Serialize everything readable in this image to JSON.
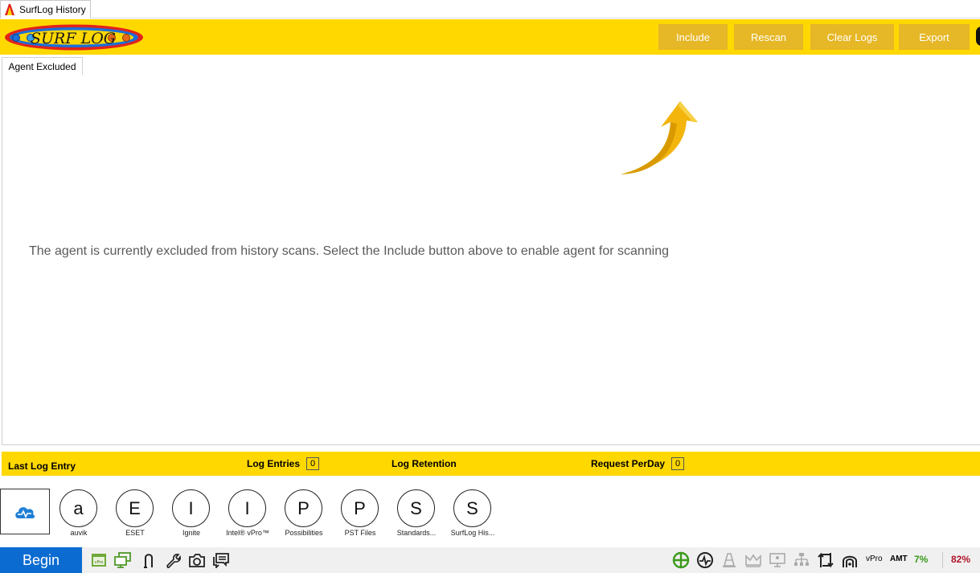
{
  "window": {
    "title": "SurfLog History"
  },
  "toolbar": {
    "logo_text": "SURF LOG",
    "buttons": [
      "Include",
      "Rescan",
      "Clear Logs",
      "Export"
    ]
  },
  "tabs": [
    {
      "label": "Agent Excluded"
    }
  ],
  "main": {
    "message": "The agent is currently excluded from history scans. Select the Include button above to enable agent for scanning"
  },
  "status": {
    "last_log_entry_label": "Last Log Entry",
    "log_entries_label": "Log Entries",
    "log_entries_value": "0",
    "log_retention_label": "Log Retention",
    "request_per_day_label": "Request PerDay",
    "request_per_day_value": "0"
  },
  "apps": [
    {
      "letter": "a",
      "label": "auvik"
    },
    {
      "letter": "E",
      "label": "ESET"
    },
    {
      "letter": "I",
      "label": "Ignite"
    },
    {
      "letter": "I",
      "label": "Intel® vPro™"
    },
    {
      "letter": "P",
      "label": "Possibilities"
    },
    {
      "letter": "P",
      "label": "PST Files"
    },
    {
      "letter": "S",
      "label": "Standards..."
    },
    {
      "letter": "S",
      "label": "SurfLog His..."
    }
  ],
  "taskbar": {
    "begin_label": "Begin",
    "vpro_label": "vPro",
    "amt_label": "AMT",
    "cpu_percent": "7%",
    "memory_percent": "82%"
  },
  "colors": {
    "toolbar_yellow": "#ffd800",
    "button_gold": "#e6b726",
    "begin_blue": "#0b6bd1",
    "cpu_green": "#3a9a1c",
    "memory_red": "#b0142a"
  }
}
